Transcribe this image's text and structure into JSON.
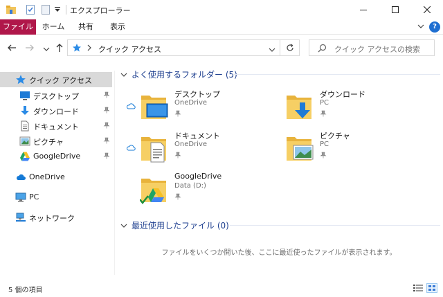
{
  "window": {
    "title": "エクスプローラー",
    "accent_color": "#b0174a"
  },
  "ribbon": {
    "tabs": [
      {
        "label": "ファイル"
      },
      {
        "label": "ホーム"
      },
      {
        "label": "共有"
      },
      {
        "label": "表示"
      }
    ],
    "help_label": "?"
  },
  "address": {
    "current_location": "クイック アクセス",
    "search_placeholder": "クイック アクセスの検索"
  },
  "sidebar": {
    "quick_access": {
      "label": "クイック アクセス",
      "icon": "star-icon"
    },
    "pinned": [
      {
        "label": "デスクトップ",
        "icon": "desktop-icon"
      },
      {
        "label": "ダウンロード",
        "icon": "download-icon"
      },
      {
        "label": "ドキュメント",
        "icon": "document-icon"
      },
      {
        "label": "ピクチャ",
        "icon": "pictures-icon"
      },
      {
        "label": "GoogleDrive",
        "icon": "google-drive-icon"
      }
    ],
    "onedrive": {
      "label": "OneDrive",
      "icon": "cloud-icon"
    },
    "pc": {
      "label": "PC",
      "icon": "computer-icon"
    },
    "network": {
      "label": "ネットワーク",
      "icon": "network-icon"
    }
  },
  "content": {
    "frequent_header": "よく使用するフォルダー (5)",
    "folders": [
      {
        "name": "デスクトップ",
        "location": "OneDrive",
        "icon": "desktop-folder-icon"
      },
      {
        "name": "ダウンロード",
        "location": "PC",
        "icon": "download-folder-icon"
      },
      {
        "name": "ドキュメント",
        "location": "OneDrive",
        "icon": "document-folder-icon"
      },
      {
        "name": "ピクチャ",
        "location": "PC",
        "icon": "pictures-folder-icon"
      },
      {
        "name": "GoogleDrive",
        "location": "Data (D:)",
        "icon": "google-drive-folder-icon"
      }
    ],
    "recent_header": "最近使用したファイル (0)",
    "recent_empty": "ファイルをいくつか開いた後、ここに最近使ったファイルが表示されます。"
  },
  "status": {
    "item_count": "5 個の項目"
  }
}
